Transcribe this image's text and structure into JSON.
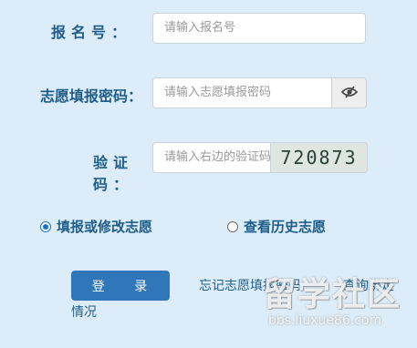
{
  "form": {
    "reg_label": "报名号：",
    "reg_placeholder": "请输入报名号",
    "pwd_label": "志愿填报密码：",
    "pwd_placeholder": "请输入志愿填报密码",
    "captcha_label": "验证码：",
    "captcha_placeholder": "请输入右边的验证码",
    "captcha_value": "720873"
  },
  "options": {
    "fill": "填报或修改志愿",
    "history": "查看历史志愿",
    "selected": "fill"
  },
  "actions": {
    "login": "登 录",
    "forgot": "忘记志愿填报密码",
    "bind_line1": "查询绑定",
    "bind_line2": "情况"
  },
  "watermark": {
    "brand": "留学社区",
    "url": "bbs.liuxue86.com"
  }
}
